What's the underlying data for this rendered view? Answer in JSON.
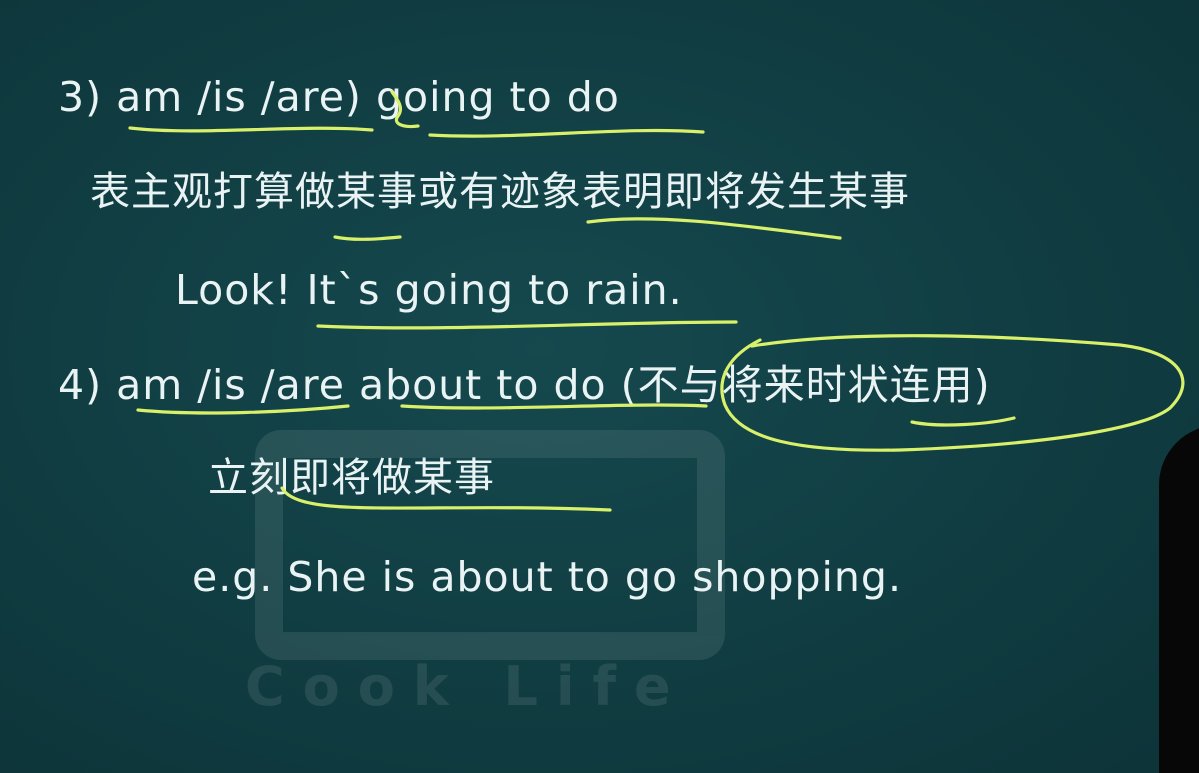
{
  "watermark": {
    "text": "Cook Life"
  },
  "slide": {
    "line1": "3) am /is /are) going to do",
    "line2": "表主观打算做某事或有迹象表明即将发生某事",
    "line3": "Look! It`s going to rain.",
    "line4": "4) am /is /are about to do (不与将来时状连用)",
    "line5": "立刻即将做某事",
    "line6": "e.g. She is about to go shopping."
  },
  "colors": {
    "background": "#113f44",
    "text": "#e9f3f4",
    "annotation": "#d8f06a"
  }
}
